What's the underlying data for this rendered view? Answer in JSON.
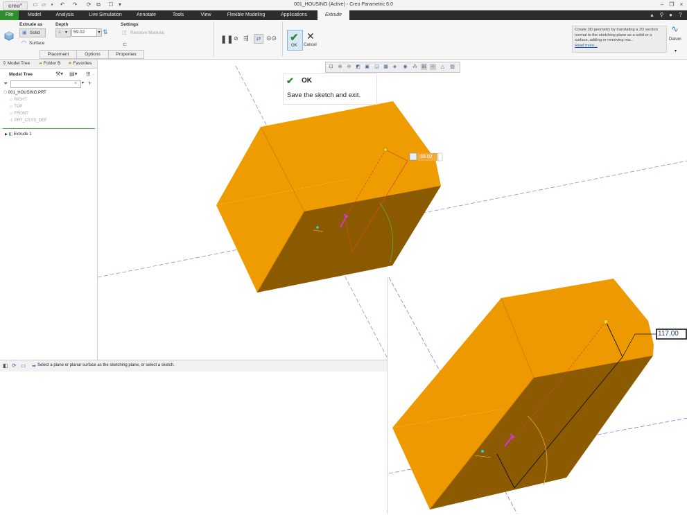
{
  "app": {
    "logo": "creo°",
    "window_title": "001_HOUSING (Active) - Creo Parametric 6.0"
  },
  "tabs": [
    {
      "label": "File"
    },
    {
      "label": "Model"
    },
    {
      "label": "Analysis"
    },
    {
      "label": "Live Simulation"
    },
    {
      "label": "Annotate"
    },
    {
      "label": "Tools"
    },
    {
      "label": "View"
    },
    {
      "label": "Flexible Modeling"
    },
    {
      "label": "Applications"
    },
    {
      "label": "Extrude"
    }
  ],
  "ribbon": {
    "extrude_as_label": "Extrude as",
    "solid_label": "Solid",
    "surface_label": "Surface",
    "depth_label": "Depth",
    "depth_value": "59.02",
    "settings_label": "Settings",
    "remove_material_label": "Remove Material",
    "ok_label": "OK",
    "cancel_label": "Cancel",
    "subtabs": [
      "Placement",
      "Options",
      "Properties"
    ],
    "help_text": "Create 3D geometry by translating a 2D section normal to the sketching plane as a solid or a surface, adding or removing ma...",
    "read_more": "Read more...",
    "datum_label": "Datum"
  },
  "left_panel": {
    "tabs": [
      "Model Tree",
      "Folder B",
      "Favorites"
    ],
    "header": "Model Tree",
    "search_placeholder": "",
    "root": "001_HOUSING.PRT",
    "datums": [
      "RIGHT",
      "TOP",
      "FRONT",
      "PRT_CSYS_DEF"
    ],
    "feature": "Extrude 1"
  },
  "tooltip": {
    "title": "OK",
    "description": "Save the sketch and exit."
  },
  "viewport": {
    "depth_tag_value": "59.02",
    "dimension_value": "117.00"
  },
  "message": {
    "text": "Select a plane or planar surface as the sketching plane, or select a sketch."
  },
  "colors": {
    "ribbon_dark": "#2d2d2d",
    "file_tab": "#2f8f2f",
    "ok_accent": "#2e8b2e",
    "model_light": "#ee9900",
    "model_dark": "#8c5a00",
    "datum_line": "#8877cc"
  }
}
